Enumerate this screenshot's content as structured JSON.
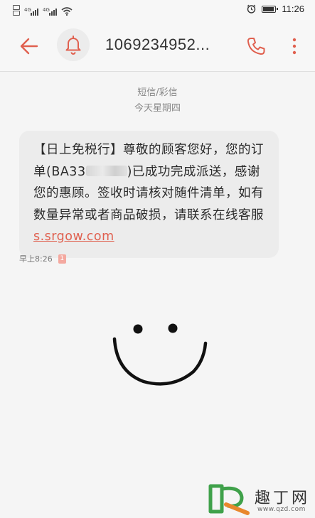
{
  "status_bar": {
    "network_tag_1": "4G",
    "network_tag_2": "4G",
    "time": "11:26"
  },
  "header": {
    "contact_number": "1069234952...",
    "icons": [
      "back-arrow-icon",
      "bell-icon",
      "phone-icon",
      "more-vert-icon"
    ],
    "accent_color": "#e0604f"
  },
  "conversation": {
    "channel_label": "短信/彩信",
    "date_label": "今天星期四",
    "message": {
      "text_before_redaction": "【日上免税行】尊敬的顾客您好，您的订单(BA33",
      "text_after_redaction": ")已成功完成派送，感谢您的惠顾。签收时请核对随件清单，如有数量异常或者商品破损，请联系在线客服",
      "link_text": "s.srgow.com",
      "time": "早上8:26",
      "sim_badge": "1"
    }
  },
  "watermark": {
    "brand": "趣丁网",
    "url": "www.qzd.com"
  }
}
